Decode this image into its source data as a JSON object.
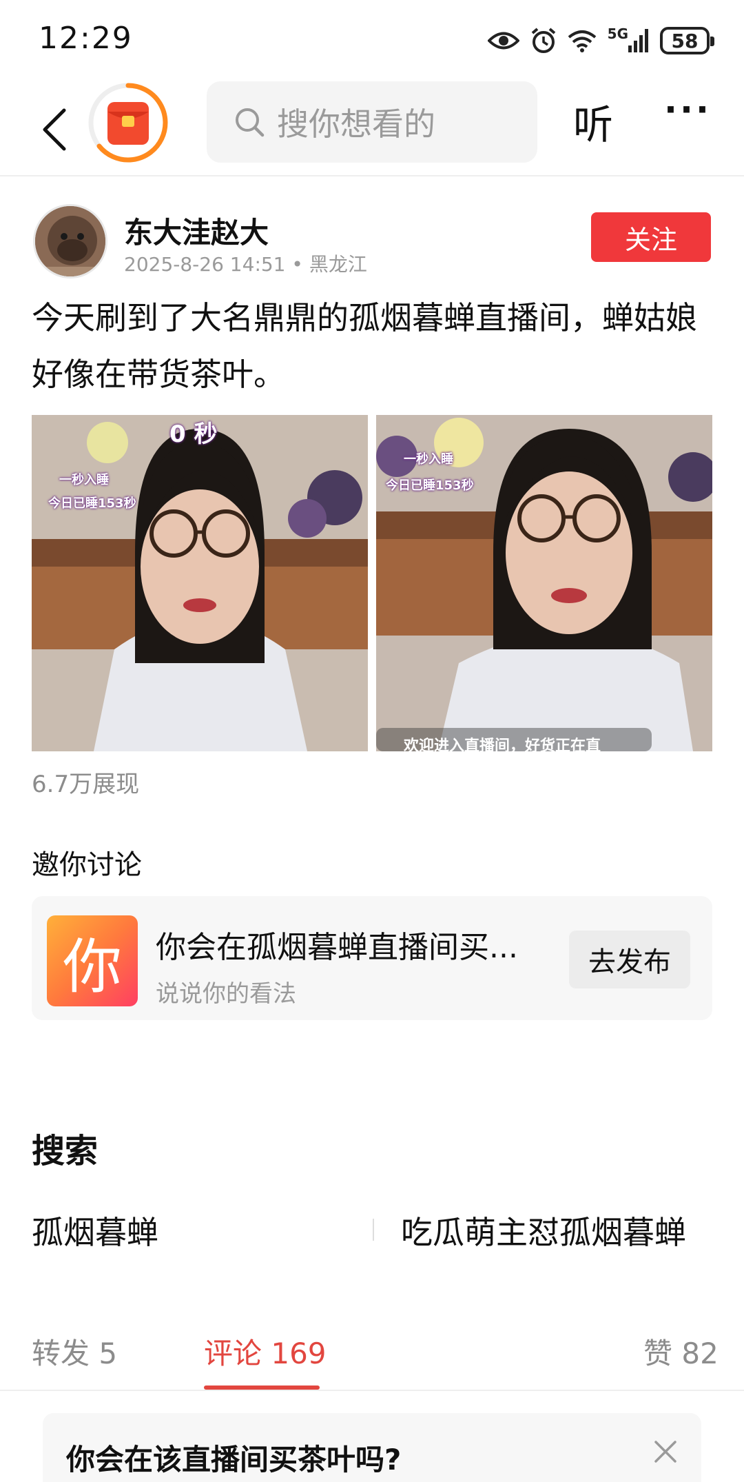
{
  "status_bar": {
    "time": "12:29",
    "network": "5G",
    "battery": "58",
    "icons": [
      "eye-icon",
      "alarm-icon",
      "wifi-icon",
      "signal-icon",
      "battery-icon"
    ]
  },
  "nav": {
    "search_placeholder": "搜你想看的",
    "listen_label": "听",
    "more_label": "···"
  },
  "post": {
    "author": "东大洼赵大",
    "date": "2025-8-26 14:51",
    "location": "黑龙江",
    "meta_separator": "•",
    "follow_label": "关注",
    "text": "今天刷到了大名鼎鼎的孤烟暮蝉直播间，蝉姑娘好像在带货茶叶。",
    "views": "6.7万展现",
    "images": [
      {
        "overlay_top": "0 秒",
        "overlay_line1": "一秒入睡",
        "overlay_line2": "今日已睡153秒"
      },
      {
        "overlay_line1": "一秒入睡",
        "overlay_line2": "今日已睡153秒",
        "overlay_bottom": "欢迎进入直播间，好货正在直"
      }
    ]
  },
  "discussion": {
    "title": "邀你讨论",
    "badge": "你",
    "question": "你会在孤烟暮蝉直播间买...",
    "subtitle": "说说你的看法",
    "publish_label": "去发布"
  },
  "search_section": {
    "heading": "搜索",
    "terms": [
      "孤烟暮蝉",
      "吃瓜萌主怼孤烟暮蝉"
    ]
  },
  "tabs": {
    "repost": "转发 5",
    "comment": "评论 169",
    "like": "赞 82",
    "active": "comment"
  },
  "poll": {
    "question": "你会在该直播间买茶叶吗?"
  },
  "colors": {
    "accent_red": "#f0383b",
    "tab_red": "#e2463f",
    "muted_gray": "#9a9a9a"
  }
}
